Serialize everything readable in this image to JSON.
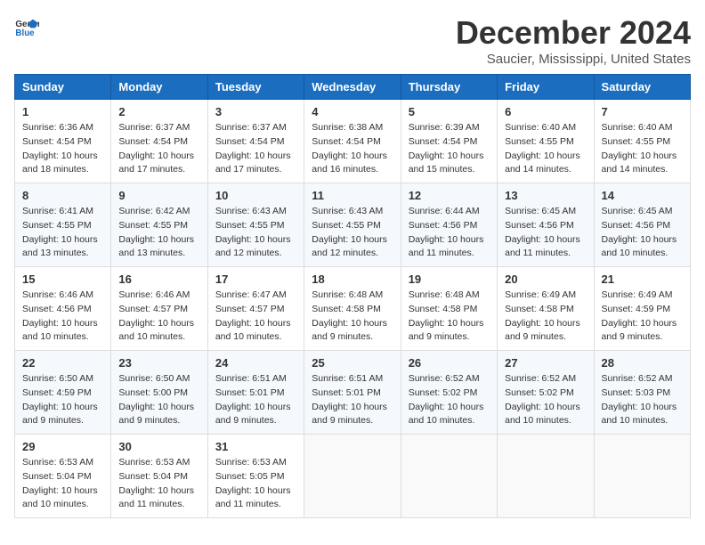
{
  "logo": {
    "text_general": "General",
    "text_blue": "Blue"
  },
  "title": "December 2024",
  "location": "Saucier, Mississippi, United States",
  "days_of_week": [
    "Sunday",
    "Monday",
    "Tuesday",
    "Wednesday",
    "Thursday",
    "Friday",
    "Saturday"
  ],
  "weeks": [
    [
      {
        "day": "1",
        "sunrise": "6:36 AM",
        "sunset": "4:54 PM",
        "daylight": "10 hours and 18 minutes."
      },
      {
        "day": "2",
        "sunrise": "6:37 AM",
        "sunset": "4:54 PM",
        "daylight": "10 hours and 17 minutes."
      },
      {
        "day": "3",
        "sunrise": "6:37 AM",
        "sunset": "4:54 PM",
        "daylight": "10 hours and 17 minutes."
      },
      {
        "day": "4",
        "sunrise": "6:38 AM",
        "sunset": "4:54 PM",
        "daylight": "10 hours and 16 minutes."
      },
      {
        "day": "5",
        "sunrise": "6:39 AM",
        "sunset": "4:54 PM",
        "daylight": "10 hours and 15 minutes."
      },
      {
        "day": "6",
        "sunrise": "6:40 AM",
        "sunset": "4:55 PM",
        "daylight": "10 hours and 14 minutes."
      },
      {
        "day": "7",
        "sunrise": "6:40 AM",
        "sunset": "4:55 PM",
        "daylight": "10 hours and 14 minutes."
      }
    ],
    [
      {
        "day": "8",
        "sunrise": "6:41 AM",
        "sunset": "4:55 PM",
        "daylight": "10 hours and 13 minutes."
      },
      {
        "day": "9",
        "sunrise": "6:42 AM",
        "sunset": "4:55 PM",
        "daylight": "10 hours and 13 minutes."
      },
      {
        "day": "10",
        "sunrise": "6:43 AM",
        "sunset": "4:55 PM",
        "daylight": "10 hours and 12 minutes."
      },
      {
        "day": "11",
        "sunrise": "6:43 AM",
        "sunset": "4:55 PM",
        "daylight": "10 hours and 12 minutes."
      },
      {
        "day": "12",
        "sunrise": "6:44 AM",
        "sunset": "4:56 PM",
        "daylight": "10 hours and 11 minutes."
      },
      {
        "day": "13",
        "sunrise": "6:45 AM",
        "sunset": "4:56 PM",
        "daylight": "10 hours and 11 minutes."
      },
      {
        "day": "14",
        "sunrise": "6:45 AM",
        "sunset": "4:56 PM",
        "daylight": "10 hours and 10 minutes."
      }
    ],
    [
      {
        "day": "15",
        "sunrise": "6:46 AM",
        "sunset": "4:56 PM",
        "daylight": "10 hours and 10 minutes."
      },
      {
        "day": "16",
        "sunrise": "6:46 AM",
        "sunset": "4:57 PM",
        "daylight": "10 hours and 10 minutes."
      },
      {
        "day": "17",
        "sunrise": "6:47 AM",
        "sunset": "4:57 PM",
        "daylight": "10 hours and 10 minutes."
      },
      {
        "day": "18",
        "sunrise": "6:48 AM",
        "sunset": "4:58 PM",
        "daylight": "10 hours and 9 minutes."
      },
      {
        "day": "19",
        "sunrise": "6:48 AM",
        "sunset": "4:58 PM",
        "daylight": "10 hours and 9 minutes."
      },
      {
        "day": "20",
        "sunrise": "6:49 AM",
        "sunset": "4:58 PM",
        "daylight": "10 hours and 9 minutes."
      },
      {
        "day": "21",
        "sunrise": "6:49 AM",
        "sunset": "4:59 PM",
        "daylight": "10 hours and 9 minutes."
      }
    ],
    [
      {
        "day": "22",
        "sunrise": "6:50 AM",
        "sunset": "4:59 PM",
        "daylight": "10 hours and 9 minutes."
      },
      {
        "day": "23",
        "sunrise": "6:50 AM",
        "sunset": "5:00 PM",
        "daylight": "10 hours and 9 minutes."
      },
      {
        "day": "24",
        "sunrise": "6:51 AM",
        "sunset": "5:01 PM",
        "daylight": "10 hours and 9 minutes."
      },
      {
        "day": "25",
        "sunrise": "6:51 AM",
        "sunset": "5:01 PM",
        "daylight": "10 hours and 9 minutes."
      },
      {
        "day": "26",
        "sunrise": "6:52 AM",
        "sunset": "5:02 PM",
        "daylight": "10 hours and 10 minutes."
      },
      {
        "day": "27",
        "sunrise": "6:52 AM",
        "sunset": "5:02 PM",
        "daylight": "10 hours and 10 minutes."
      },
      {
        "day": "28",
        "sunrise": "6:52 AM",
        "sunset": "5:03 PM",
        "daylight": "10 hours and 10 minutes."
      }
    ],
    [
      {
        "day": "29",
        "sunrise": "6:53 AM",
        "sunset": "5:04 PM",
        "daylight": "10 hours and 10 minutes."
      },
      {
        "day": "30",
        "sunrise": "6:53 AM",
        "sunset": "5:04 PM",
        "daylight": "10 hours and 11 minutes."
      },
      {
        "day": "31",
        "sunrise": "6:53 AM",
        "sunset": "5:05 PM",
        "daylight": "10 hours and 11 minutes."
      },
      null,
      null,
      null,
      null
    ]
  ]
}
